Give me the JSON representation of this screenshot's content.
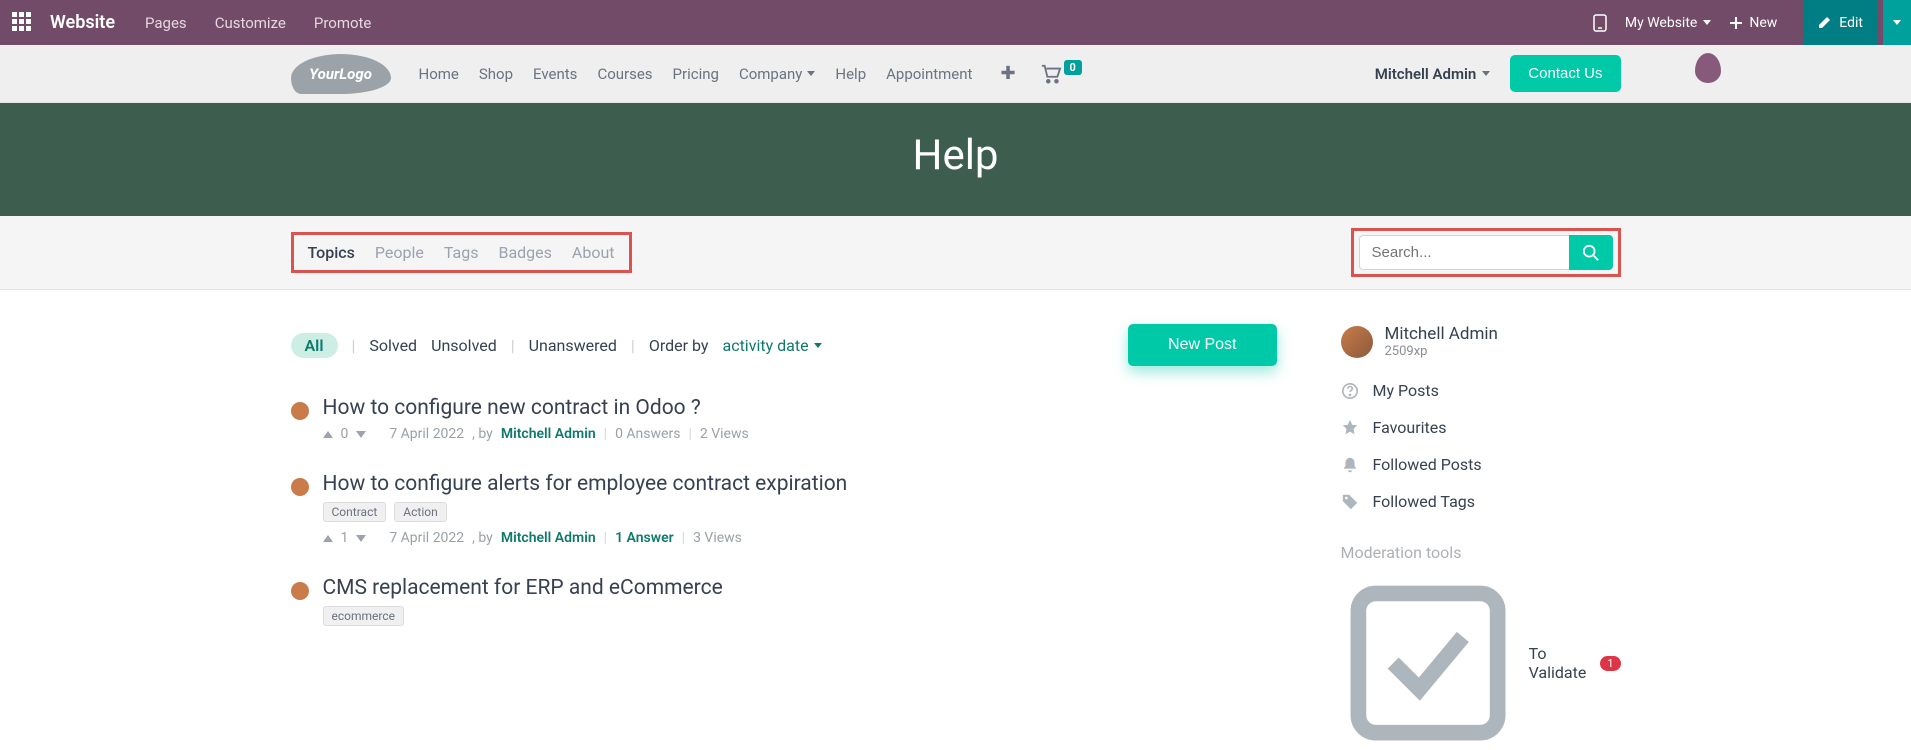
{
  "topbar": {
    "brand": "Website",
    "menu": [
      "Pages",
      "Customize",
      "Promote"
    ],
    "site_selector": "My Website",
    "new": "New",
    "edit": "Edit"
  },
  "navbar": {
    "logo_text": "YourLogo",
    "items": [
      "Home",
      "Shop",
      "Events",
      "Courses",
      "Pricing",
      "Company",
      "Help",
      "Appointment"
    ],
    "cart_count": "0",
    "user": "Mitchell Admin",
    "contact": "Contact Us"
  },
  "hero": {
    "title": "Help"
  },
  "tabs": [
    "Topics",
    "People",
    "Tags",
    "Badges",
    "About"
  ],
  "search": {
    "placeholder": "Search..."
  },
  "filters": {
    "all": "All",
    "solved": "Solved",
    "unsolved": "Unsolved",
    "unanswered": "Unanswered",
    "order_label": "Order by",
    "order_value": "activity date",
    "new_post": "New Post"
  },
  "topics": [
    {
      "title": "How to configure new contract in Odoo ?",
      "votes": "0",
      "date": "7 April 2022",
      "author": "Mitchell Admin",
      "answers": "0 Answers",
      "answers_has": false,
      "views": "2 Views",
      "tags": []
    },
    {
      "title": "How to configure alerts for employee contract expiration",
      "votes": "1",
      "date": "7 April 2022",
      "author": "Mitchell Admin",
      "answers": "1 Answer",
      "answers_has": true,
      "views": "3 Views",
      "tags": [
        "Contract",
        "Action"
      ]
    },
    {
      "title": "CMS replacement for ERP and eCommerce",
      "votes": "",
      "date": "",
      "author": "",
      "answers": "",
      "answers_has": false,
      "views": "",
      "tags": [
        "ecommerce"
      ]
    }
  ],
  "sidebar": {
    "profile_name": "Mitchell Admin",
    "profile_xp": "2509xp",
    "links": [
      "My Posts",
      "Favourites",
      "Followed Posts",
      "Followed Tags"
    ],
    "mod_heading": "Moderation tools",
    "mod_validate": "To Validate",
    "mod_badge": "1"
  },
  "meta_labels": {
    "by": ", by "
  }
}
